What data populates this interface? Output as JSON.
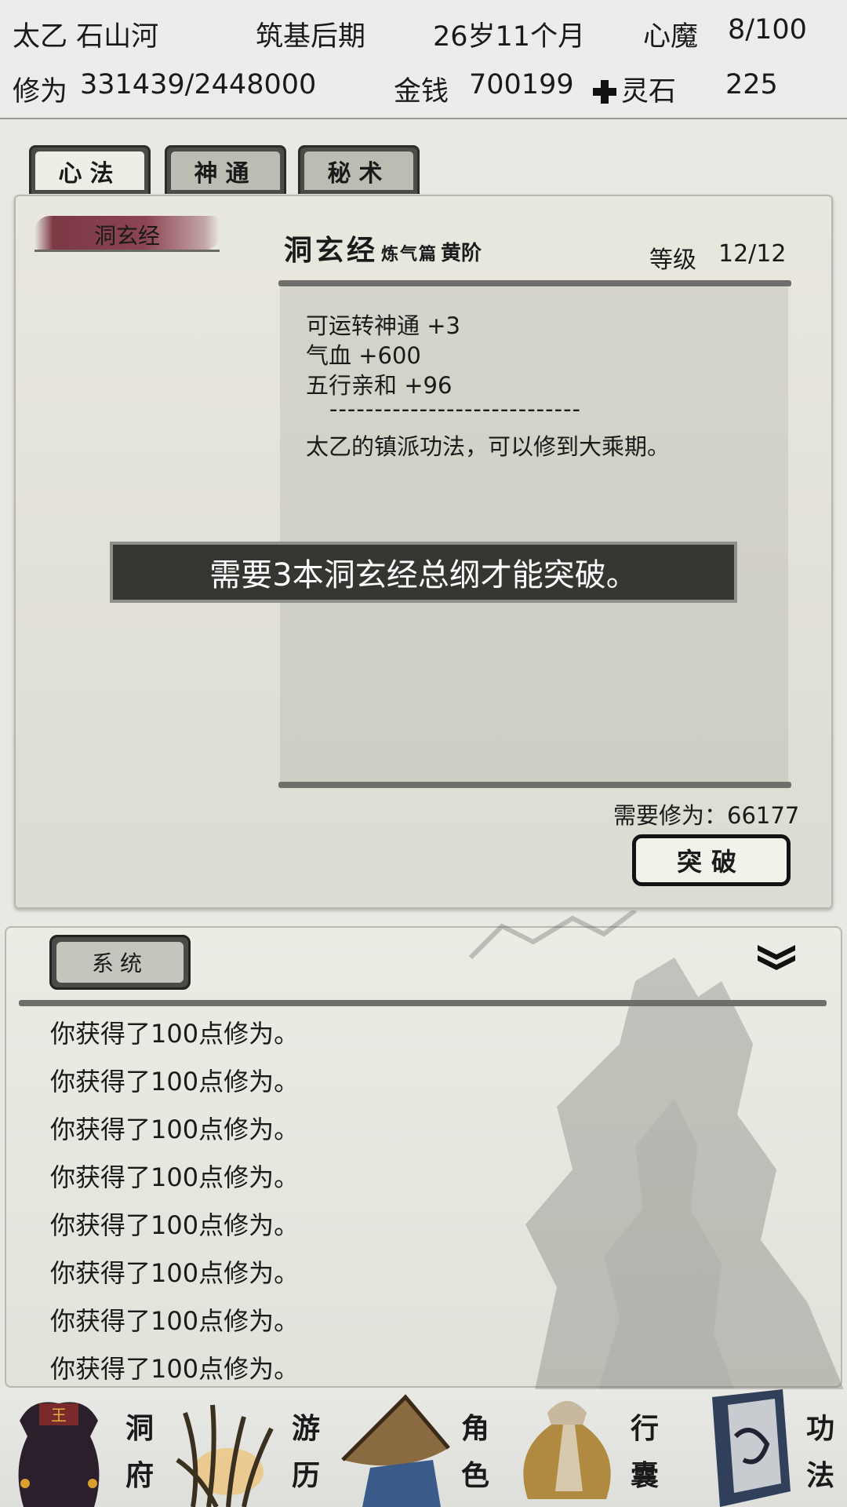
{
  "status": {
    "name": "太乙 石山河",
    "realm": "筑基后期",
    "age": "26岁11个月",
    "heart_demon_label": "心魔",
    "heart_demon_value": "8/100",
    "cultivation_label": "修为",
    "cultivation_value": "331439/2448000",
    "money_label": "金钱",
    "money_value": "700199",
    "spirit_stone_label": "灵石",
    "spirit_stone_value": "225",
    "spirit_stone_icon": "cross-diamond-icon"
  },
  "tabs": [
    {
      "label": "心法",
      "active": true
    },
    {
      "label": "神通",
      "active": false
    },
    {
      "label": "秘术",
      "active": false
    }
  ],
  "technique": {
    "list_item": "洞玄经",
    "title": "洞玄经",
    "subtitle": "炼气篇",
    "grade": "黄阶",
    "level_label": "等级",
    "level_value": "12/12",
    "effects": [
      "可运转神通 +3",
      "气血 +600",
      "五行亲和 +96"
    ],
    "divider": "----------------------------",
    "description": "太乙的镇派功法，可以修到大乘期。",
    "required_label": "需要修为：",
    "required_value": "66177",
    "breakthrough_label": "突破"
  },
  "toast": "需要3本洞玄经总纲才能突破。",
  "log": {
    "tab_label": "系统",
    "collapse_icon": "double-chevron-down-icon",
    "messages": [
      "你获得了100点修为。",
      "你获得了100点修为。",
      "你获得了100点修为。",
      "你获得了100点修为。",
      "你获得了100点修为。",
      "你获得了100点修为。",
      "你获得了100点修为。",
      "你获得了100点修为。"
    ]
  },
  "nav": [
    {
      "label1": "洞",
      "label2": "府",
      "icon": "cave-bag-icon"
    },
    {
      "label1": "游",
      "label2": "历",
      "icon": "grass-icon"
    },
    {
      "label1": "角",
      "label2": "色",
      "icon": "straw-hat-icon"
    },
    {
      "label1": "行",
      "label2": "囊",
      "icon": "pouch-icon"
    },
    {
      "label1": "功",
      "label2": "法",
      "icon": "manual-book-icon"
    }
  ]
}
